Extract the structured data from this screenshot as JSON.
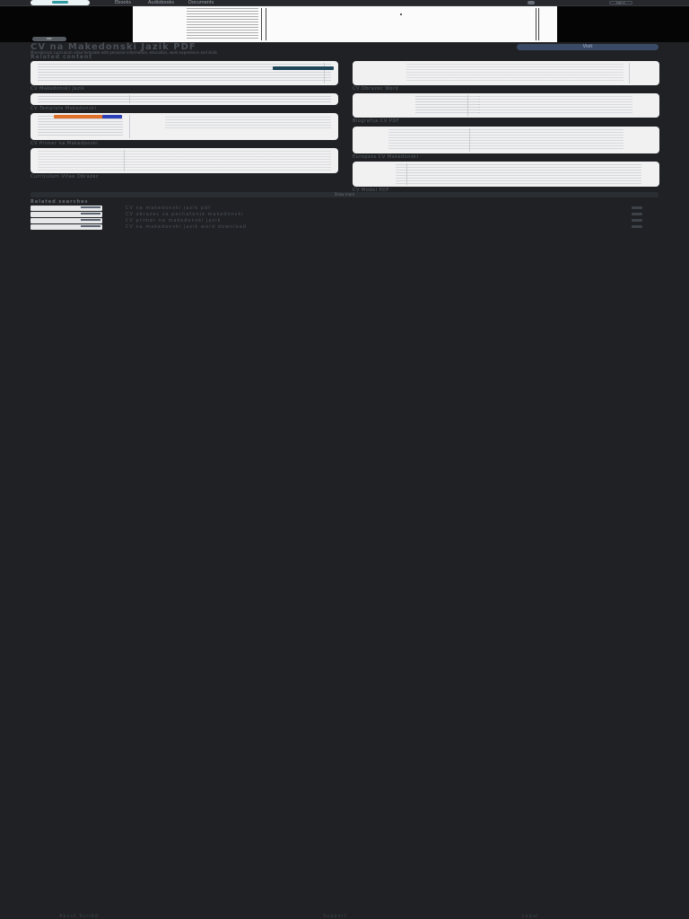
{
  "nav": {
    "brand_label": "Scribd",
    "links": [
      "Ebooks",
      "Audiobooks",
      "Documents",
      "Ne"
    ],
    "signin_label": "Sign in"
  },
  "hero": {
    "badge": "PDF"
  },
  "document": {
    "title": "CV na Makedonski Jazik PDF",
    "subtitle": "Macedonian curriculum vitae template with personal information, education, work experience and skills",
    "section_title": "Related content",
    "visit_label": "Visit"
  },
  "cards": [
    {
      "caption": "CV Makedonski Jazik",
      "tag": "PDF"
    },
    {
      "caption": "CV Obrazec Word",
      "tag": ""
    },
    {
      "caption": "CV Template Makedonski",
      "tag": ""
    },
    {
      "caption": "Biografija CV PDF",
      "tag": ""
    },
    {
      "caption": "CV Primer na Makedonski",
      "tag": ""
    },
    {
      "caption": "Europass CV Makedonski",
      "tag": ""
    },
    {
      "caption": "Curriculum Vitae Obrazec",
      "tag": ""
    },
    {
      "caption": "CV Model PDF",
      "tag": ""
    }
  ],
  "divider_label": "Show more",
  "related": {
    "title": "Related searches",
    "items": [
      "CV na makedonski jazik pdf",
      "CV obrazec za pechatenje makedonski",
      "CV primer na makedonski jazik",
      "CV na makedonski jazik word download"
    ]
  },
  "footer": {
    "links": [
      "About Scribd",
      "Support",
      "Legal"
    ]
  },
  "colors": {
    "background": "#1f2124",
    "accent": "#2f9aa2",
    "visit_button": "#3a4a66"
  }
}
